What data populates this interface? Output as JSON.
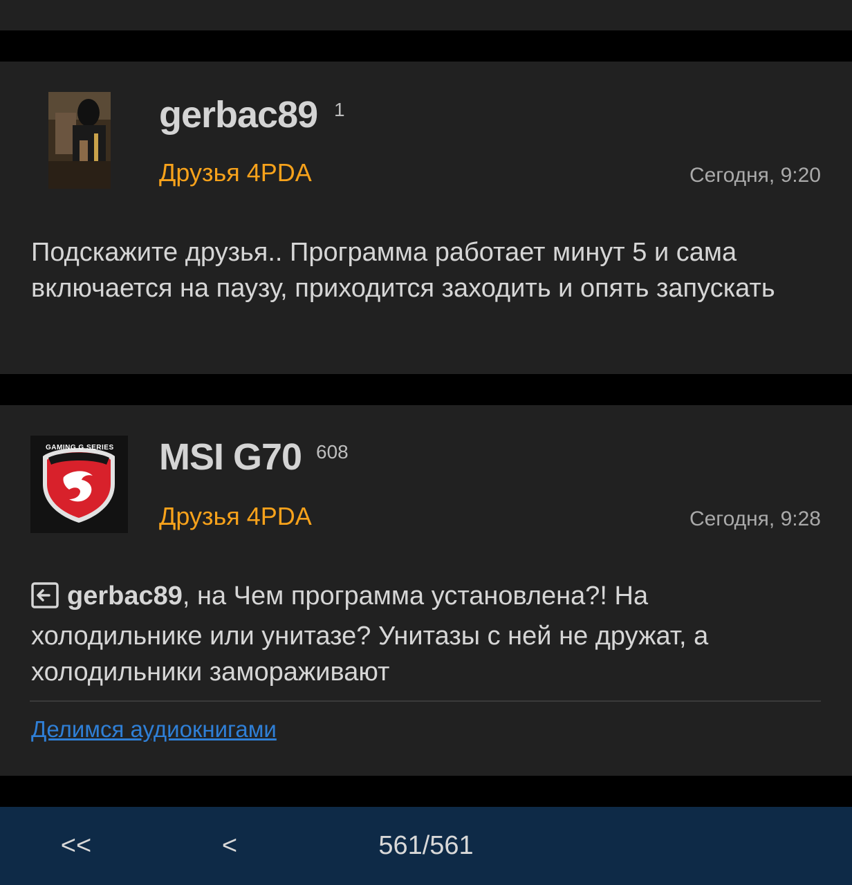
{
  "posts": [
    {
      "username": "gerbac89",
      "reputation": "1",
      "group": "Друзья 4PDA",
      "date": "Сегодня, 9:20",
      "text": "Подскажите друзья.. Программа работает минут 5 и сама включается на паузу, приходится заходить и опять запускать"
    },
    {
      "username": "MSI G70",
      "reputation": "608",
      "group": "Друзья 4PDA",
      "date": "Сегодня, 9:28",
      "mention": "gerbac89",
      "text": ", на Чем программа установлена?! На холодильнике или унитазе?  Унитазы с ней не дружат, а холодильники замораживают",
      "signature_link": "Делимся аудиокнигами",
      "avatar_badge": "GAMING G SERIES"
    }
  ],
  "pagination": {
    "first_label": "<<",
    "prev_label": "<",
    "counter": "561/561"
  },
  "colors": {
    "background": "#000000",
    "card": "#212121",
    "group": "#f7a21b",
    "link": "#2f7fd6",
    "bottom_bar": "#0e2a47"
  }
}
